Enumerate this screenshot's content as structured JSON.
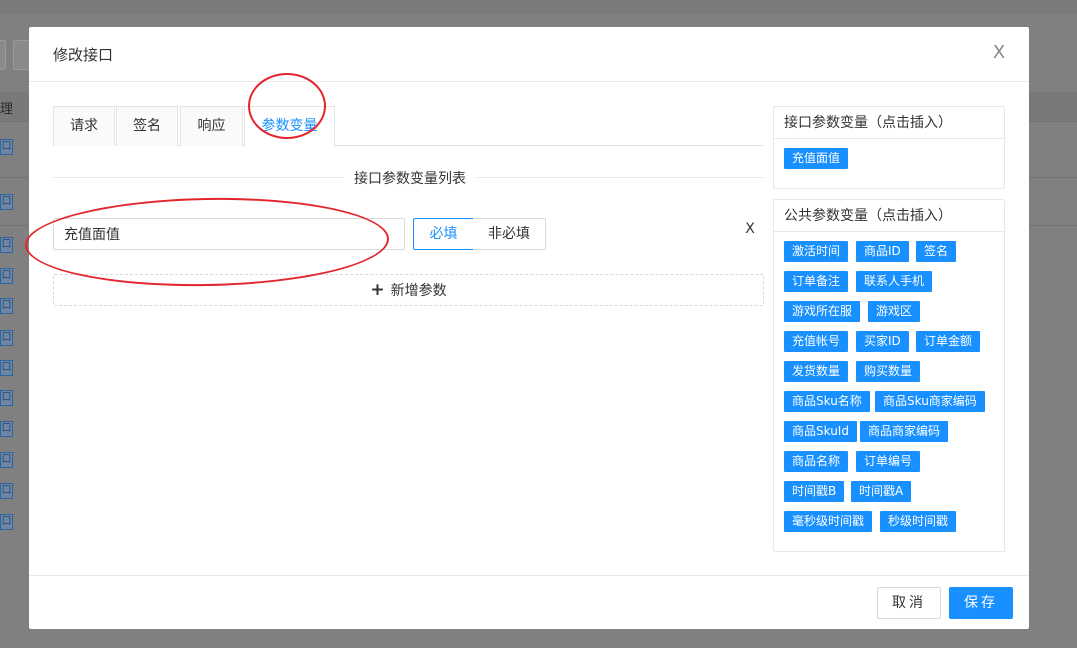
{
  "backdrop": {
    "header_fragment": "理",
    "row_tag": "口"
  },
  "modal": {
    "title": "修改接口",
    "close_label": "X"
  },
  "tabs": [
    {
      "label": "请求"
    },
    {
      "label": "签名"
    },
    {
      "label": "响应"
    },
    {
      "label": "参数变量",
      "active": true
    }
  ],
  "params_section": {
    "title": "接口参数变量列表",
    "params": [
      {
        "name": "充值面值",
        "required_label": "必填",
        "optional_label": "非必填",
        "required": true,
        "remove_label": "X"
      }
    ],
    "add_label": "新增参数",
    "add_icon": "+"
  },
  "interface_vars_panel": {
    "title": "接口参数变量（点击插入）",
    "tags": [
      "充值面值"
    ]
  },
  "public_vars_panel": {
    "title": "公共参数变量（点击插入）",
    "tags": [
      "激活时间",
      "商品ID",
      "签名",
      "订单备注",
      "联系人手机",
      "游戏所在服",
      "游戏区",
      "充值帐号",
      "买家ID",
      "订单金额",
      "发货数量",
      "购买数量",
      "商品Sku名称",
      "商品Sku商家编码",
      "商品SkuId",
      "商品商家编码",
      "商品名称",
      "订单编号",
      "时间戳B",
      "时间戳A",
      "毫秒级时间戳",
      "秒级时间戳"
    ]
  },
  "footer": {
    "cancel_label": "取消",
    "save_label": "保存"
  },
  "colors": {
    "primary": "#1890ff",
    "annotation": "#e3262d"
  }
}
